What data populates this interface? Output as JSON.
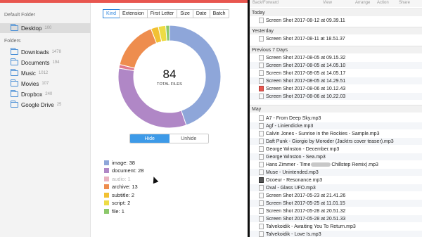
{
  "sidebar": {
    "default_folder_label": "Default Folder",
    "default_folder": {
      "name": "Desktop",
      "count": "100"
    },
    "folders_label": "Folders",
    "folders": [
      {
        "name": "Downloads",
        "count": "1478"
      },
      {
        "name": "Documents",
        "count": "194"
      },
      {
        "name": "Music",
        "count": "1012"
      },
      {
        "name": "Movies",
        "count": "107"
      },
      {
        "name": "Dropbox",
        "count": "240"
      },
      {
        "name": "Google Drive",
        "count": "25"
      }
    ]
  },
  "tabs": [
    "Kind",
    "Extension",
    "First Letter",
    "Size",
    "Date",
    "Batch"
  ],
  "active_tab": "Kind",
  "donut": {
    "count": "84",
    "label": "TOTAL FILES"
  },
  "hide_toggle": {
    "hide": "Hide",
    "unhide": "Unhide"
  },
  "chart_data": {
    "type": "pie",
    "variant": "donut",
    "total": 84,
    "slices": [
      {
        "name": "image",
        "value": 38,
        "color": "#8ea6d9"
      },
      {
        "name": "document",
        "value": 28,
        "color": "#b087c6"
      },
      {
        "name": "audio",
        "value": 1,
        "color": "#e07a8e"
      },
      {
        "name": "archive",
        "value": 13,
        "color": "#ee8d4e"
      },
      {
        "name": "subtitle",
        "value": 2,
        "color": "#f2c133"
      },
      {
        "name": "script",
        "value": 2,
        "color": "#eddc45"
      },
      {
        "name": "file",
        "value": 1,
        "color": "#8cc86b"
      }
    ]
  },
  "legend": [
    {
      "text": "image: 38",
      "color": "#8ea6d9"
    },
    {
      "text": "document: 28",
      "color": "#b087c6"
    },
    {
      "text": "audio: 1",
      "color": "#e9b3c0",
      "dim": true
    },
    {
      "text": "archive: 13",
      "color": "#ee8d4e"
    },
    {
      "text": "subtitle: 2",
      "color": "#f2c133"
    },
    {
      "text": "script: 2",
      "color": "#eddc45"
    },
    {
      "text": "file: 1",
      "color": "#8cc86b"
    }
  ],
  "finder": {
    "toolbar": {
      "back_forward": "Back/Forward",
      "view": "View",
      "arrange": "Arrange",
      "action": "Action",
      "share": "Share"
    },
    "today_label": "Today",
    "today": [
      "Screen Shot 2017-08-12 at 09.39.11"
    ],
    "yesterday_label": "Yesterday",
    "yesterday": [
      "Screen Shot 2017-08-11 at 18.51.37"
    ],
    "prev7_label": "Previous 7 Days",
    "prev7": [
      "Screen Shot 2017-08-05 at 09.15.32",
      "Screen Shot 2017-08-05 at 14.05.10",
      "Screen Shot 2017-08-05 at 14.05.17",
      "Screen Shot 2017-08-05 at 14.29.51",
      "Screen Shot 2017-08-06 at 10.12.43",
      "Screen Shot 2017-08-06 at 10.22.03"
    ],
    "may_label": "May",
    "may": [
      "A7 - From Deep Sky.mp3",
      "Agf - Liniendicke.mp3",
      "Calvin Jones - Sunrise in the Rockies - Sample.mp3",
      "Daft Punk - Giorgio by Moroder (Jacktrs cover teaser).mp3",
      "George Winston - December.mp3",
      "George Winston - Sea.mp3",
      "Hans Zimmer - Time",
      "Muse - Unintended.mp3",
      "Ocoeur - Resonance.mp3",
      "Oval - Glass UFO.mp3",
      "Screen Shot 2017-05-23 at 21.41.26",
      "Screen Shot 2017-05-25 at 11.01.15",
      "Screen Shot 2017-05-28 at 20.51.32",
      "Screen Shot 2017-05-28 at 20.51.33",
      "Talvekoidik - Awaiting You To Return.mp3",
      "Talvekoidik - Love Is.mp3"
    ],
    "hans_suffix": "Chillstep Remix).mp3"
  }
}
